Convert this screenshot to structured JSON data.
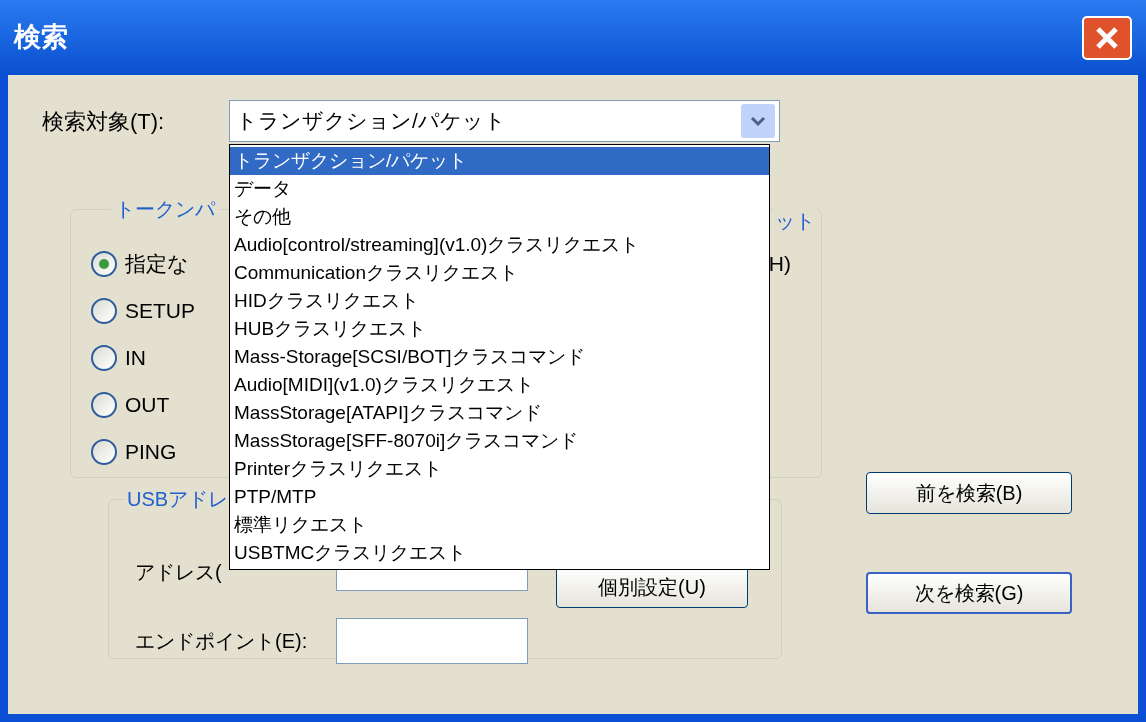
{
  "window": {
    "title": "検索"
  },
  "target": {
    "label": "検索対象(T):",
    "value": "トランザクション/パケット"
  },
  "dropdown": {
    "items": [
      {
        "label": "トランザクション/パケット",
        "selected": true
      },
      {
        "label": "データ",
        "selected": false
      },
      {
        "label": "その他",
        "selected": false
      },
      {
        "label": "Audio[control/streaming](v1.0)クラスリクエスト",
        "selected": false
      },
      {
        "label": "Communicationクラスリクエスト",
        "selected": false
      },
      {
        "label": "HIDクラスリクエスト",
        "selected": false
      },
      {
        "label": "HUBクラスリクエスト",
        "selected": false
      },
      {
        "label": "Mass-Storage[SCSI/BOT]クラスコマンド",
        "selected": false
      },
      {
        "label": "Audio[MIDI](v1.0)クラスリクエスト",
        "selected": false
      },
      {
        "label": "MassStorage[ATAPI]クラスコマンド",
        "selected": false
      },
      {
        "label": "MassStorage[SFF-8070i]クラスコマンド",
        "selected": false
      },
      {
        "label": "Printerクラスリクエスト",
        "selected": false
      },
      {
        "label": "PTP/MTP",
        "selected": false
      },
      {
        "label": "標準リクエスト",
        "selected": false
      },
      {
        "label": "USBTMCクラスリクエスト",
        "selected": false
      }
    ]
  },
  "token_group": {
    "title": "トークンパ",
    "title_right": "ット",
    "right_fragment": "H)",
    "radios": [
      {
        "label": "指定な",
        "selected": true
      },
      {
        "label": "SETUP",
        "selected": false
      },
      {
        "label": "IN",
        "selected": false
      },
      {
        "label": "OUT",
        "selected": false
      },
      {
        "label": "PING",
        "selected": false
      }
    ]
  },
  "usb_group": {
    "title": "USBアドレ",
    "address_label": "アドレス(",
    "endpoint_label": "エンドポイント(E):",
    "individual_button": "個別設定(U)"
  },
  "buttons": {
    "prev": "前を検索(B)",
    "next": "次を検索(G)"
  }
}
